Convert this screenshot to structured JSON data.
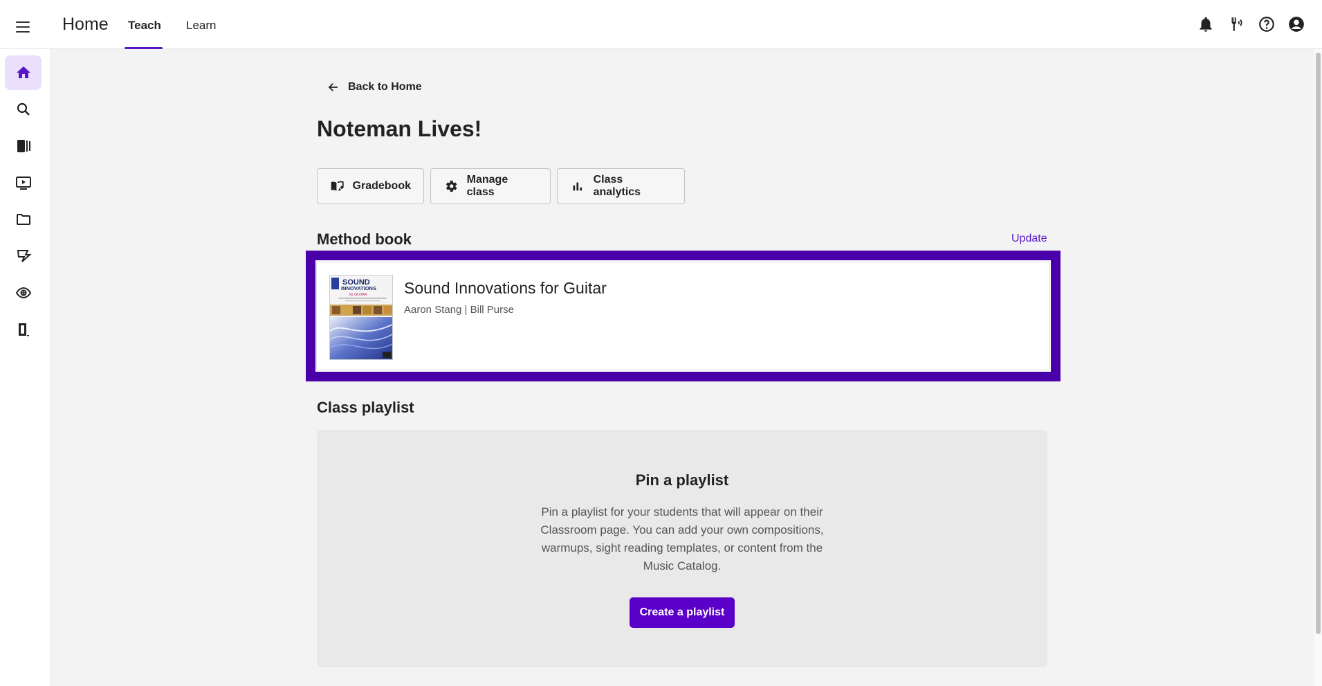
{
  "header": {
    "app_title": "Home",
    "tabs": [
      {
        "label": "Teach",
        "active": true
      },
      {
        "label": "Learn",
        "active": false
      }
    ],
    "icons": [
      "notifications-icon",
      "tuner-icon",
      "help-icon",
      "account-icon"
    ]
  },
  "sidebar": {
    "items": [
      {
        "icon": "home-icon",
        "active": true
      },
      {
        "icon": "search-icon",
        "active": false
      },
      {
        "icon": "library-icon",
        "active": false
      },
      {
        "icon": "video-icon",
        "active": false
      },
      {
        "icon": "folder-icon",
        "active": false
      },
      {
        "icon": "assignment-icon",
        "active": false
      },
      {
        "icon": "ear-icon",
        "active": false
      },
      {
        "icon": "classroom-door-icon",
        "active": false
      }
    ]
  },
  "main": {
    "back_label": "Back to Home",
    "title": "Noteman Lives!",
    "actions": [
      {
        "label": "Gradebook",
        "icon": "gradebook-icon"
      },
      {
        "label": "Manage class",
        "icon": "gear-icon"
      },
      {
        "label": "Class analytics",
        "icon": "bar-chart-icon"
      }
    ],
    "method_book": {
      "section_title": "Method book",
      "update_label": "Update",
      "cover_title_line1": "SOUND",
      "cover_title_line2": "INNOVATIONS",
      "cover_subtitle": "for GUITAR",
      "title": "Sound Innovations for Guitar",
      "authors": "Aaron Stang | Bill Purse"
    },
    "class_playlist": {
      "section_title": "Class playlist",
      "empty_title": "Pin a playlist",
      "empty_text": "Pin a playlist for your students that will appear on their Classroom page. You can add your own compositions, warmups, sight reading templates, or content from the Music Catalog.",
      "create_label": "Create a playlist"
    }
  },
  "colors": {
    "accent": "#5a17c9",
    "highlight_frame": "#4a00a8",
    "primary_button": "#5a00c8"
  }
}
